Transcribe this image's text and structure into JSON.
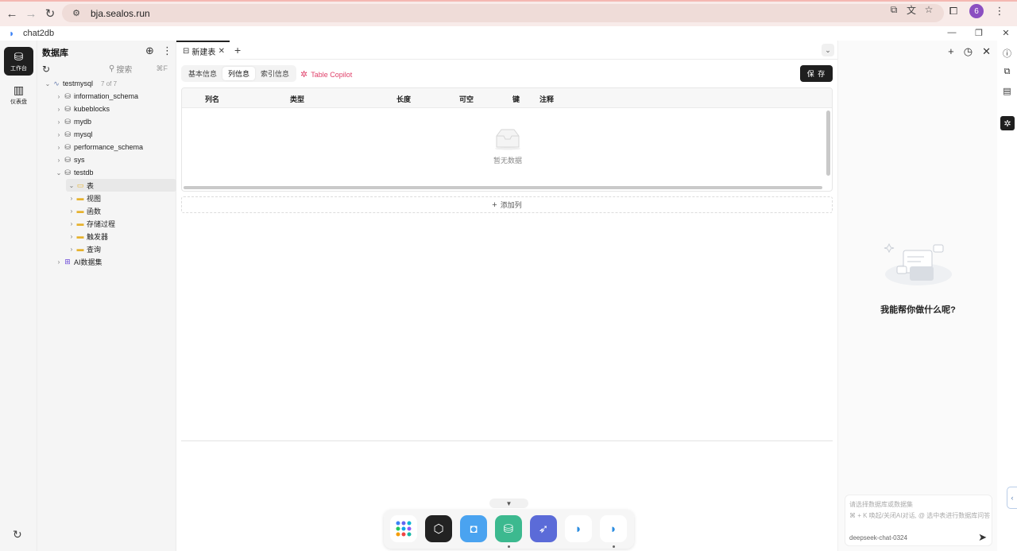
{
  "browser": {
    "url": "bja.sealos.run",
    "profile_initial": "6"
  },
  "app": {
    "name": "chat2db"
  },
  "rail": {
    "workbench_label": "工作台",
    "dashboard_label": "仪表盘"
  },
  "sidebar": {
    "title": "数据库",
    "search_placeholder": "搜索",
    "search_shortcut": "⌘F",
    "connection": {
      "name": "testmysql",
      "count": "7 of 7"
    },
    "databases": [
      "information_schema",
      "kubeblocks",
      "mydb",
      "mysql",
      "performance_schema",
      "sys",
      "testdb"
    ],
    "testdb_children": [
      "表",
      "视图",
      "函数",
      "存储过程",
      "触发器",
      "查询"
    ],
    "ai_dataset": "AI数据集"
  },
  "main": {
    "tab_label": "新建表",
    "subtabs": [
      "基本信息",
      "列信息",
      "索引信息"
    ],
    "active_subtab": "列信息",
    "copilot_label": "Table Copilot",
    "save_label": "保 存",
    "columns": [
      "列名",
      "类型",
      "长度",
      "可空",
      "键",
      "注释"
    ],
    "empty_text": "暂无数据",
    "add_column_label": "添加列"
  },
  "ai_panel": {
    "question": "我能帮你做什么呢?",
    "input_placeholder": "请选择数据库或数据集",
    "input_hint": "⌘ + K 唤起/关闭AI对话, @ 选中表进行数据库问答",
    "model": "deepseek-chat-0324"
  },
  "colors": {
    "accent_dark": "#1f1f1f",
    "copilot": "#e0406a",
    "browser_bg": "#f8ebe9"
  }
}
